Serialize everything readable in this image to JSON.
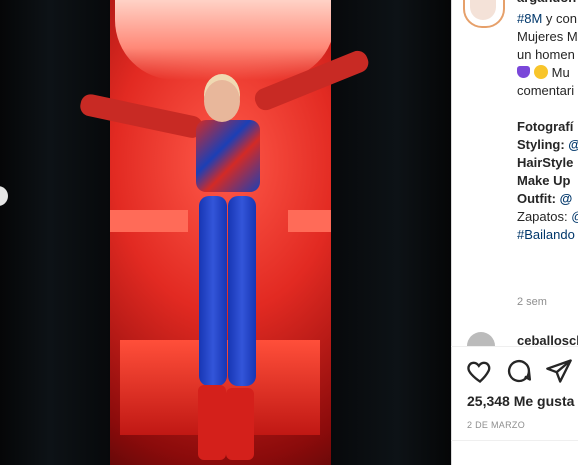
{
  "post": {
    "username": "argandon",
    "caption_lines": [
      {
        "text": "#8M y con",
        "kind": "hashtag-mixed"
      },
      {
        "text": "Mujeres M",
        "kind": "plain"
      },
      {
        "text": "un homen",
        "kind": "plain"
      },
      {
        "text": " Mu",
        "kind": "emoji-line"
      },
      {
        "text": "comentari",
        "kind": "plain"
      },
      {
        "text": "",
        "kind": "blank"
      },
      {
        "text": "Fotografí",
        "kind": "bold"
      },
      {
        "text": "Styling: @",
        "kind": "bold-mention"
      },
      {
        "text": "HairStyle",
        "kind": "bold"
      },
      {
        "text": "Make Up",
        "kind": "bold"
      },
      {
        "text": "Outfit: @",
        "kind": "bold-mention"
      },
      {
        "text": "Zapatos: @",
        "kind": "plain-mention"
      },
      {
        "text": "#Bailando",
        "kind": "hashtag"
      }
    ],
    "time_ago": "2 sem",
    "comment_username": "ceballoscl",
    "likes": "25,348 Me gusta",
    "date": "2 DE MARZO"
  },
  "icons": [
    "heart-icon",
    "comment-icon",
    "share-icon"
  ],
  "colors": {
    "link": "#00376b",
    "text": "#262626",
    "muted": "#8e8e8e"
  }
}
